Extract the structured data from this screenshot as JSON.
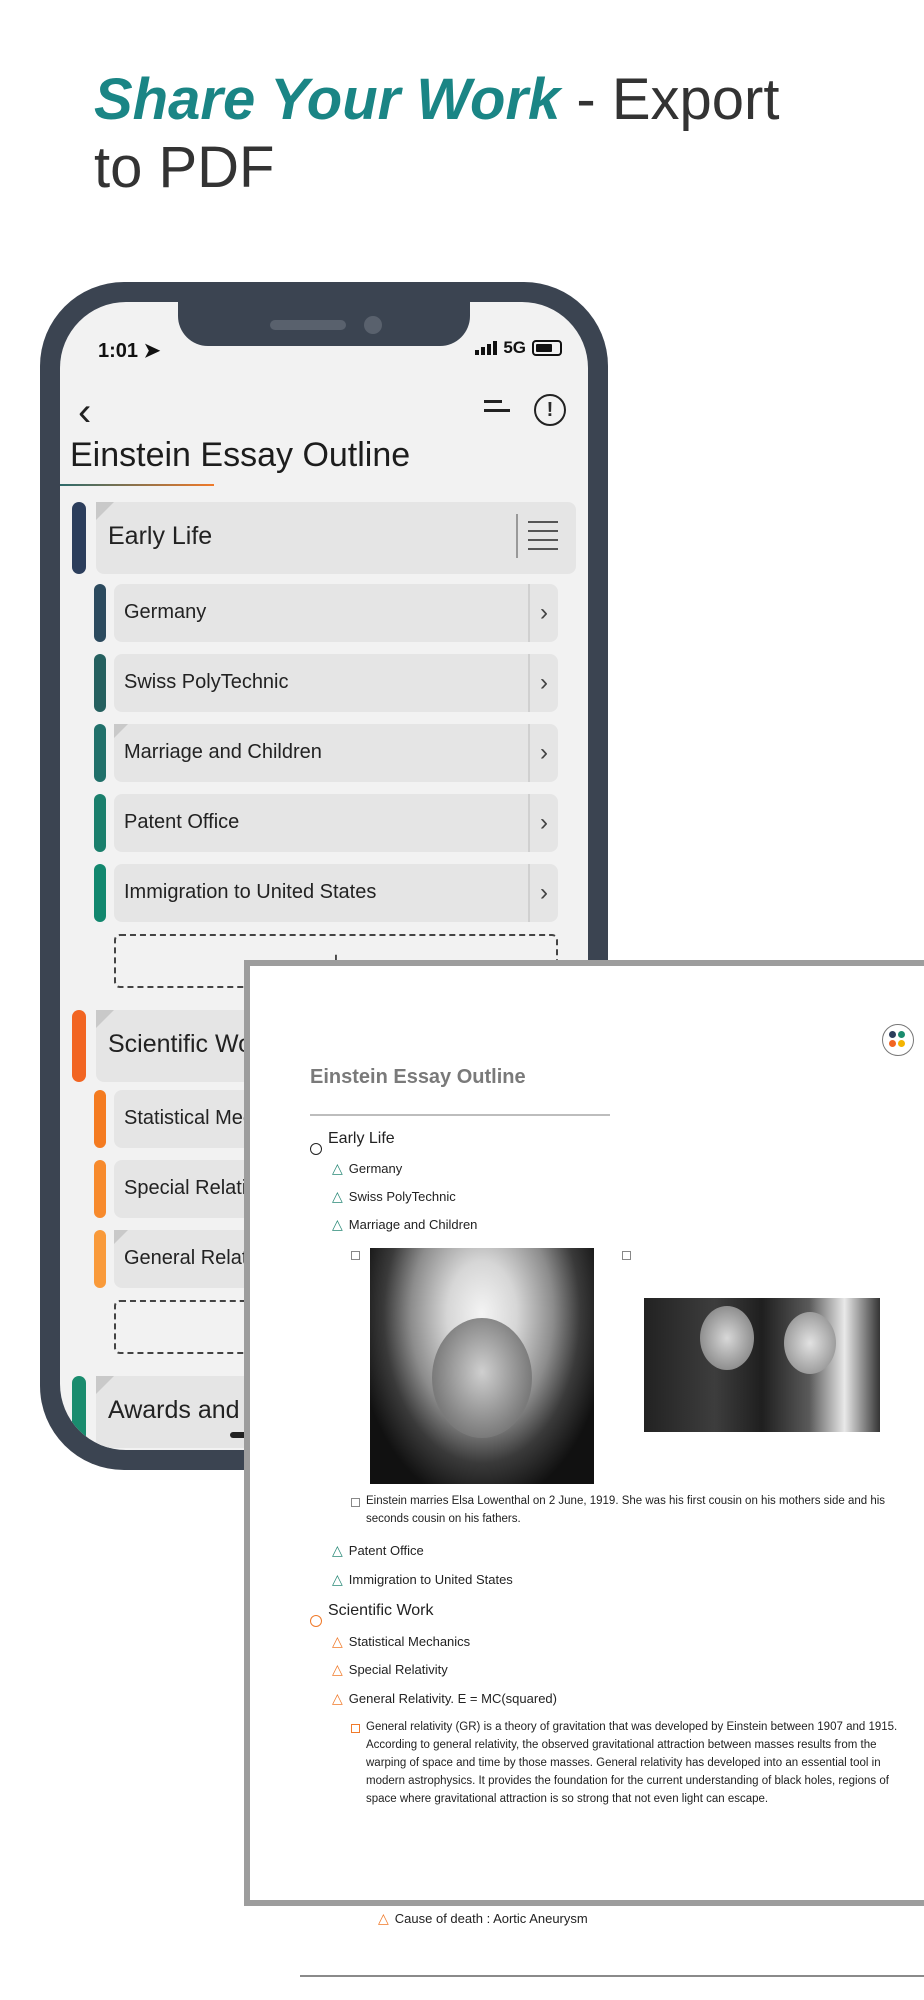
{
  "headline": {
    "accent": "Share Your Work",
    "rest": " - Export to PDF"
  },
  "phone": {
    "status": {
      "time": "1:01",
      "network": "5G"
    },
    "outline_title": "Einstein Essay Outline",
    "sections": [
      {
        "label": "Early Life",
        "color": "#2c3e5c"
      },
      {
        "label": "Scientific Work",
        "color": "#f26522"
      },
      {
        "label": "Awards and Honors",
        "color": "#1a8c6e"
      }
    ],
    "early_life_items": [
      {
        "label": "Germany",
        "color": "#2c4a5e"
      },
      {
        "label": "Swiss PolyTechnic",
        "color": "#25605f"
      },
      {
        "label": "Marriage and Children",
        "color": "#20706a"
      },
      {
        "label": "Patent Office",
        "color": "#1a7f6c"
      },
      {
        "label": "Immigration to United States",
        "color": "#12876e"
      }
    ],
    "scientific_items": [
      {
        "label": "Statistical Mechanics",
        "color": "#f47b20"
      },
      {
        "label": "Special Relativity",
        "color": "#f78a2c"
      },
      {
        "label": "General Relativity",
        "color": "#f99a3a"
      }
    ],
    "add_label": "+"
  },
  "pdf": {
    "title": "Einstein Essay Outline",
    "early_life": "Early Life",
    "items_a": [
      "Germany",
      "Swiss PolyTechnic",
      "Marriage and Children"
    ],
    "caption": "Einstein marries Elsa Lowenthal on 2 June, 1919. She was his first cousin on his mothers side and his seconds cousin on his fathers.",
    "items_b": [
      "Patent Office",
      "Immigration to United States"
    ],
    "scientific": "Scientific Work",
    "items_c": [
      "Statistical Mechanics",
      "Special Relativity",
      "General Relativity. E = MC(squared)"
    ],
    "gr_paragraph": "General relativity (GR) is a theory of gravitation that was developed by Einstein between 1907 and 1915. According to general relativity, the observed gravitational attraction between masses results from the warping of space and time by those masses. General relativity has developed into an essential tool in modern astrophysics. It provides the foundation for the current understanding of black holes, regions of space where gravitational attraction is so strong that not even light can escape.",
    "death": "Cause of death : Aortic Aneurysm"
  }
}
